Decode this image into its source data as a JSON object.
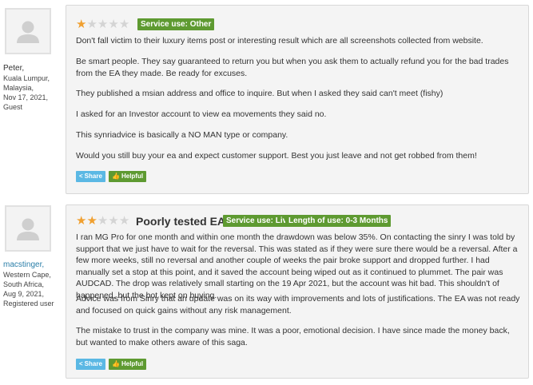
{
  "reviews": [
    {
      "author": {
        "name": "Peter,",
        "location_line1": "Kuala Lumpur,",
        "location_line2": "Malaysia,",
        "date": "Nov 17, 2021,",
        "role": "Guest"
      },
      "rating": 1,
      "max_rating": 5,
      "title": "",
      "tags": [
        "Service use: Other"
      ],
      "paragraphs": [
        "Don't fall victim to their luxury items post or interesting result which are all screenshots collected from website.",
        "Be smart people. They say guaranteed to return you but when you ask them to actually refund you for the bad trades from the EA they made. Be ready for excuses.",
        "They published a msian address and office to inquire. But when I asked they said can't meet (fishy)",
        "I asked for an Investor account to view ea movements they said no.",
        "This synriadvice is basically a NO MAN type or company.",
        "Would you still buy your ea and expect customer support. Best you just leave and not get robbed from them!"
      ],
      "share_label": "Share",
      "helpful_label": "Helpful"
    },
    {
      "author": {
        "name": "macstinger,",
        "location_line1": "Western Cape,",
        "location_line2": "South Africa,",
        "date": "Aug 9, 2021,",
        "role": "Registered user"
      },
      "rating": 2,
      "max_rating": 5,
      "title": "Poorly tested EA's",
      "tags": [
        "Service use: Live",
        "Length of use: 0-3 Months"
      ],
      "paragraphs": [
        "I ran MG Pro for one month and within one month the drawdown was below 35%. On contacting the sinry I was told by support that we just have to wait for the reversal. This was stated as if they were sure there would be a reversal. After a few more weeks, still no reversal and another couple of weeks the pair broke support and dropped further. I had manually set a stop at this point, and it saved the account being wiped out as it continued to plummet. The pair was AUDCAD. The drop was relatively small starting on the 19 Apr 2021, but the account was hit bad. This shouldn't of happened, but the bot kept on buying.",
        "Advice was from Sinry that an update was on its way with improvements and lots of justifications. The EA was not ready and focused on quick gains without any risk management.",
        "The mistake to trust in the company was mine. It was a poor, emotional decision. I have since made the money back, but wanted to make others aware of this saga."
      ],
      "share_label": "Share",
      "helpful_label": "Helpful"
    }
  ],
  "colors": {
    "star_on": "#f0a030",
    "star_off": "#d4d4d4",
    "badge_green": "#5e9a31",
    "share_blue": "#5bb8e4",
    "username_link": "#2a7ea8"
  },
  "icons": {
    "avatar": "user-silhouette-icon",
    "share": "share-icon",
    "helpful": "thumbs-up-icon"
  }
}
